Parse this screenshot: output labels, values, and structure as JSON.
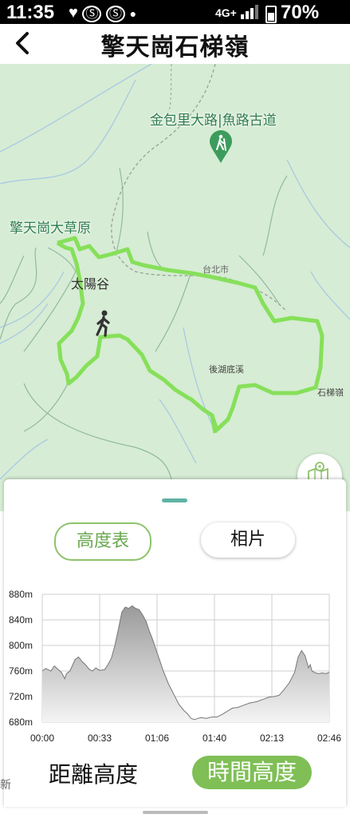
{
  "status_bar": {
    "time": "11:35",
    "icons": [
      "heart-icon",
      "app-notification-icon",
      "app-notification-icon",
      "dot-icon"
    ],
    "network": "4G+",
    "battery": "70%"
  },
  "header": {
    "title": "擎天崗石梯嶺",
    "back_icon": "chevron-left-icon"
  },
  "map": {
    "labels": {
      "trail_poi": "金包里大路|魚路古道",
      "grassland": "擎天崗大草原",
      "valley": "太陽谷",
      "taipei_city": "台北市",
      "creek": "後湖底溪",
      "ridge": "石梯嶺"
    },
    "route_color": "#86e05a",
    "icons": [
      "hiker-poi-marker-icon",
      "hiker-position-icon",
      "map-toggle-icon"
    ]
  },
  "sheet": {
    "tab_elevation": "高度表",
    "tab_photos": "相片",
    "mode_distance": "距離高度",
    "mode_time": "時間高度",
    "accent": "#7fbf56"
  },
  "chart_data": {
    "type": "area",
    "x_tick_labels": [
      "00:00",
      "00:33",
      "01:06",
      "01:40",
      "02:13",
      "02:46"
    ],
    "y_tick_labels": [
      "880m",
      "840m",
      "800m",
      "760m",
      "720m",
      "680m"
    ],
    "ylim": [
      680,
      880
    ],
    "xlim_minutes": [
      0,
      166
    ],
    "grid": true,
    "series": [
      {
        "points_minutes_meters": [
          [
            0,
            760
          ],
          [
            2,
            764
          ],
          [
            5,
            760
          ],
          [
            7,
            768
          ],
          [
            9,
            763
          ],
          [
            11,
            758
          ],
          [
            13,
            748
          ],
          [
            14,
            756
          ],
          [
            16,
            760
          ],
          [
            19,
            778
          ],
          [
            21,
            782
          ],
          [
            23,
            775
          ],
          [
            25,
            770
          ],
          [
            27,
            763
          ],
          [
            29,
            760
          ],
          [
            31,
            765
          ],
          [
            33,
            761
          ],
          [
            36,
            762
          ],
          [
            38,
            770
          ],
          [
            40,
            780
          ],
          [
            42,
            800
          ],
          [
            44,
            825
          ],
          [
            46,
            852
          ],
          [
            48,
            860
          ],
          [
            50,
            858
          ],
          [
            52,
            862
          ],
          [
            54,
            858
          ],
          [
            56,
            856
          ],
          [
            58,
            848
          ],
          [
            60,
            838
          ],
          [
            62,
            822
          ],
          [
            64,
            808
          ],
          [
            66,
            792
          ],
          [
            68,
            776
          ],
          [
            70,
            760
          ],
          [
            73,
            740
          ],
          [
            76,
            724
          ],
          [
            79,
            708
          ],
          [
            82,
            698
          ],
          [
            84,
            693
          ],
          [
            86,
            686
          ],
          [
            88,
            684
          ],
          [
            90,
            686
          ],
          [
            92,
            687
          ],
          [
            95,
            686
          ],
          [
            98,
            688
          ],
          [
            101,
            688
          ],
          [
            104,
            692
          ],
          [
            107,
            697
          ],
          [
            110,
            702
          ],
          [
            113,
            703
          ],
          [
            116,
            706
          ],
          [
            120,
            710
          ],
          [
            124,
            712
          ],
          [
            128,
            716
          ],
          [
            131,
            719
          ],
          [
            134,
            720
          ],
          [
            137,
            722
          ],
          [
            139,
            728
          ],
          [
            141,
            735
          ],
          [
            143,
            742
          ],
          [
            146,
            758
          ],
          [
            148,
            782
          ],
          [
            150,
            792
          ],
          [
            152,
            784
          ],
          [
            154,
            765
          ],
          [
            155,
            770
          ],
          [
            156,
            760
          ],
          [
            158,
            757
          ],
          [
            160,
            756
          ],
          [
            162,
            757
          ],
          [
            164,
            756
          ],
          [
            166,
            758
          ]
        ]
      }
    ]
  }
}
